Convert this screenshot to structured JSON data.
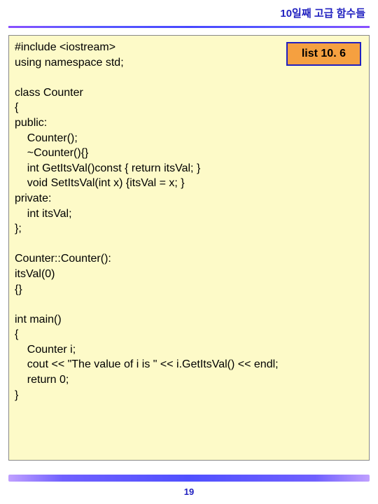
{
  "header": {
    "title": "10일째 고급 함수들"
  },
  "label": "list 10. 6",
  "code": "#include <iostream>\nusing namespace std;\n\nclass Counter\n{\npublic:\n    Counter();\n    ~Counter(){}\n    int GetItsVal()const { return itsVal; }\n    void SetItsVal(int x) {itsVal = x; }\nprivate:\n    int itsVal;\n};\n\nCounter::Counter():\nitsVal(0)\n{}\n\nint main()\n{\n    Counter i;\n    cout << \"The value of i is \" << i.GetItsVal() << endl;\n    return 0;\n}",
  "page_number": "19"
}
